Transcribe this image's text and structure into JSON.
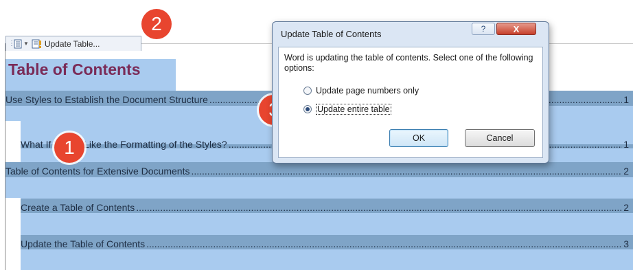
{
  "toolbar": {
    "update_label": "Update Table..."
  },
  "document": {
    "toc_title": "Table of Contents",
    "entries": [
      {
        "text": "Use Styles to Establish the Document Structure",
        "page": "1"
      },
      {
        "text": "What If I Don't Like the Formatting of the Styles?",
        "page": "1"
      },
      {
        "text": "Table of Contents for Extensive Documents",
        "page": "2"
      },
      {
        "text": "Create a Table of Contents",
        "page": "2"
      },
      {
        "text": "Update the Table of Contents",
        "page": "3"
      }
    ]
  },
  "badges": [
    "1",
    "2",
    "3"
  ],
  "dialog": {
    "title": "Update Table of Contents",
    "help_glyph": "?",
    "close_glyph": "X",
    "message": "Word is updating the table of contents.  Select one of the following options:",
    "options": [
      {
        "label": "Update page numbers only",
        "selected": false
      },
      {
        "label": "Update entire table",
        "selected": true
      }
    ],
    "ok_label": "OK",
    "cancel_label": "Cancel"
  },
  "colors": {
    "selection": "#a9cbef",
    "title": "#7a2b57",
    "badge": "#e8452f"
  }
}
